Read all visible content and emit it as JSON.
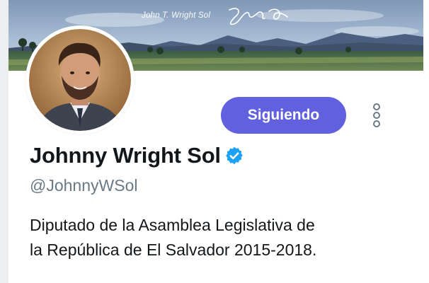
{
  "banner": {
    "caption": "John T. Wright Sol",
    "signature": "Jeg D."
  },
  "profile": {
    "display_name": "Johnny Wright Sol",
    "handle": "@JohnnyWSol",
    "verified": true,
    "bio_lines": [
      "Diputado de la Asamblea Legislativa de",
      "la República de El Salvador 2015-2018."
    ]
  },
  "actions": {
    "follow_label": "Siguiendo",
    "more_icon": "vertical-ellipsis-icon"
  },
  "colors": {
    "follow_button": "#6161e0",
    "verified_badge": "#1da1f2",
    "handle_text": "#697987",
    "name_text": "#14171a"
  }
}
